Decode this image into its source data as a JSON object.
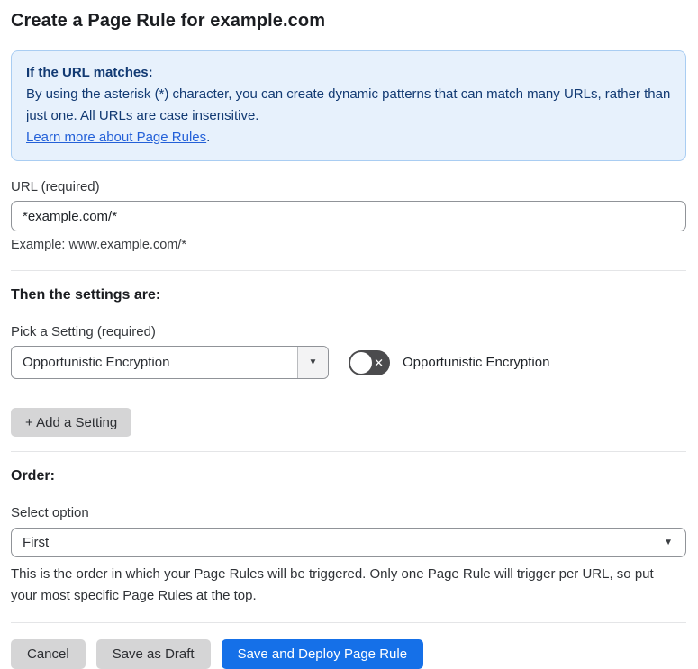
{
  "page": {
    "title": "Create a Page Rule for example.com"
  },
  "info_box": {
    "heading": "If the URL matches:",
    "body": "By using the asterisk (*) character, you can create dynamic patterns that can match many URLs, rather than just one. All URLs are case insensitive.",
    "link_label": "Learn more about Page Rules",
    "link_suffix": "."
  },
  "url_field": {
    "label": "URL (required)",
    "value": "*example.com/*",
    "helper": "Example: www.example.com/*"
  },
  "settings_section": {
    "heading": "Then the settings are:",
    "picker_label": "Pick a Setting (required)",
    "picker_value": "Opportunistic Encryption",
    "toggle_label": "Opportunistic Encryption",
    "toggle_state": "off",
    "add_setting_label": "+ Add a Setting"
  },
  "order_section": {
    "heading": "Order:",
    "select_label": "Select option",
    "select_value": "First",
    "helper": "This is the order in which your Page Rules will be triggered. Only one Page Rule will trigger per URL, so put your most specific Page Rules at the top."
  },
  "footer": {
    "cancel_label": "Cancel",
    "save_draft_label": "Save as Draft",
    "save_deploy_label": "Save and Deploy Page Rule"
  },
  "icons": {
    "dropdown_arrow_glyph": "▼",
    "toggle_off_glyph": "✕"
  },
  "colors": {
    "accent_blue": "#1570e8",
    "info_background": "#e7f1fc",
    "info_border": "#a9cdf2",
    "info_text": "#123a73",
    "link_blue": "#2360d8",
    "toggle_off_background": "#4b4b4d",
    "button_gray": "#d5d5d6"
  }
}
